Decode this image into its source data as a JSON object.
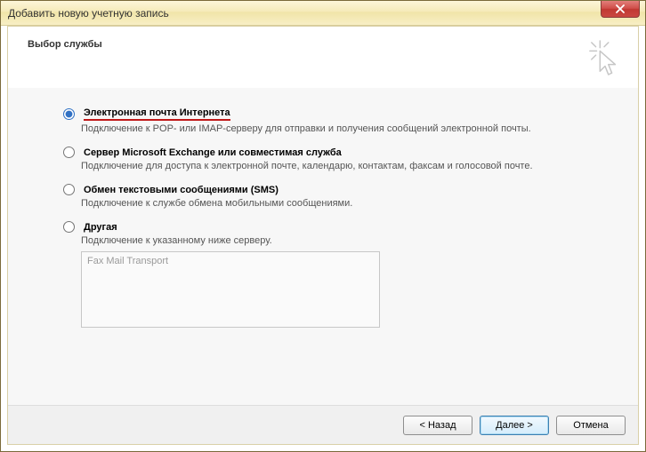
{
  "window": {
    "title": "Добавить новую учетную запись"
  },
  "header": {
    "title": "Выбор службы"
  },
  "options": [
    {
      "label": "Электронная почта Интернета",
      "desc": "Подключение к POP- или IMAP-серверу для отправки и получения сообщений электронной почты.",
      "checked": true,
      "underlined": true
    },
    {
      "label": "Сервер Microsoft Exchange или совместимая служба",
      "desc": "Подключение для доступа к электронной почте, календарю, контактам, факсам и голосовой почте.",
      "checked": false
    },
    {
      "label": "Обмен текстовыми сообщениями (SMS)",
      "desc": "Подключение к службе обмена мобильными сообщениями.",
      "checked": false
    },
    {
      "label": "Другая",
      "desc": "Подключение к указанному ниже серверу.",
      "checked": false,
      "listbox": "Fax Mail Transport"
    }
  ],
  "buttons": {
    "back": "< Назад",
    "next": "Далее >",
    "cancel": "Отмена"
  }
}
